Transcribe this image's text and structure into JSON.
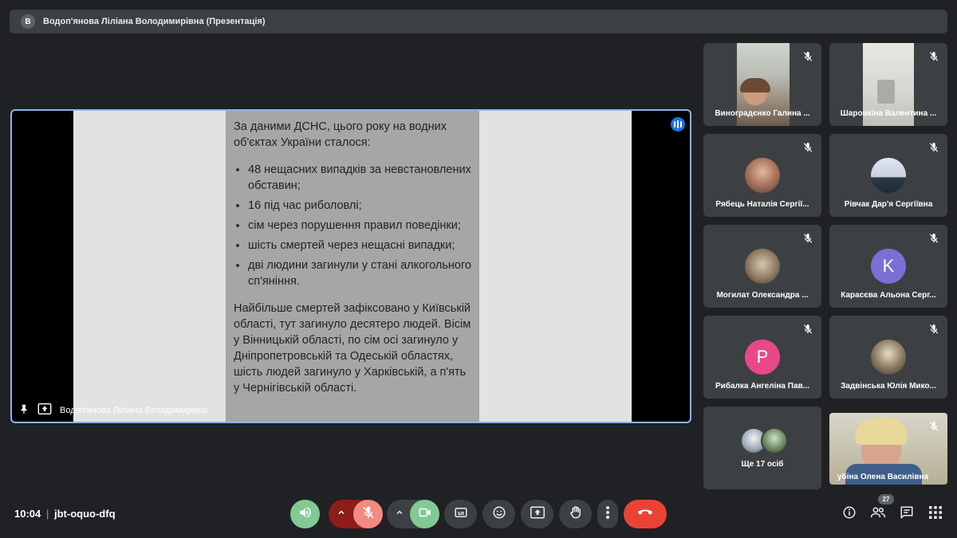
{
  "header": {
    "avatar_letter": "В",
    "title": "Водоп'янова Ліліана Володимирівна (Презентація)"
  },
  "presentation": {
    "intro": "За даними ДСНС, цього року на водних об'єктах України сталося:",
    "bullets": [
      "48 нещасних випадків за невстановлених обставин;",
      "16 під час риболовлі;",
      "сім через порушення правил поведінки;",
      "шість смертей через нещасні випадки;",
      "дві людини загинули у стані алкогольного сп'яніння."
    ],
    "paragraph": "Найбільше смертей зафіксовано у Київській області, тут загинуло десятеро людей. Вісім у Вінницькій області, по сім осі загинуло у Дніпропетровській та Одеській областях, шість людей загинуло у Харківській, а п'ять у Чернігівській області.",
    "presenter_name": "Водоп'янова Ліліана Володимирівна"
  },
  "participants": [
    {
      "name": "Виноградєнко Галина ...",
      "kind": "video"
    },
    {
      "name": "Шаровкіна Валентина ...",
      "kind": "video"
    },
    {
      "name": "Рябець Наталія Сергії...",
      "kind": "avatar"
    },
    {
      "name": "Рівчак Дар'я Сергіївна",
      "kind": "avatar"
    },
    {
      "name": "Могилат Олександра ...",
      "kind": "avatar"
    },
    {
      "name": "Карасєва Альона Серг...",
      "kind": "letter",
      "letter": "K",
      "color": "#7b6fd6"
    },
    {
      "name": "Рибалка Ангеліна Пав...",
      "kind": "letter",
      "letter": "P",
      "color": "#e8488a"
    },
    {
      "name": "Задвінська Юлія Мико...",
      "kind": "avatar"
    },
    {
      "name": "Ще 17 осіб",
      "kind": "more"
    },
    {
      "name": "убіна Олена Василівна",
      "kind": "video"
    }
  ],
  "bottom": {
    "time": "10:04",
    "separator": "|",
    "meeting_code": "jbt-oquo-dfq",
    "participant_count": "27"
  },
  "colors": {
    "accent": "#8ab4f8",
    "end_call": "#ea4335",
    "mic_off": "#f28b82",
    "mic_off_bg": "#8c1d18",
    "speaker_on": "#81c995",
    "camera_on": "#81c995"
  }
}
